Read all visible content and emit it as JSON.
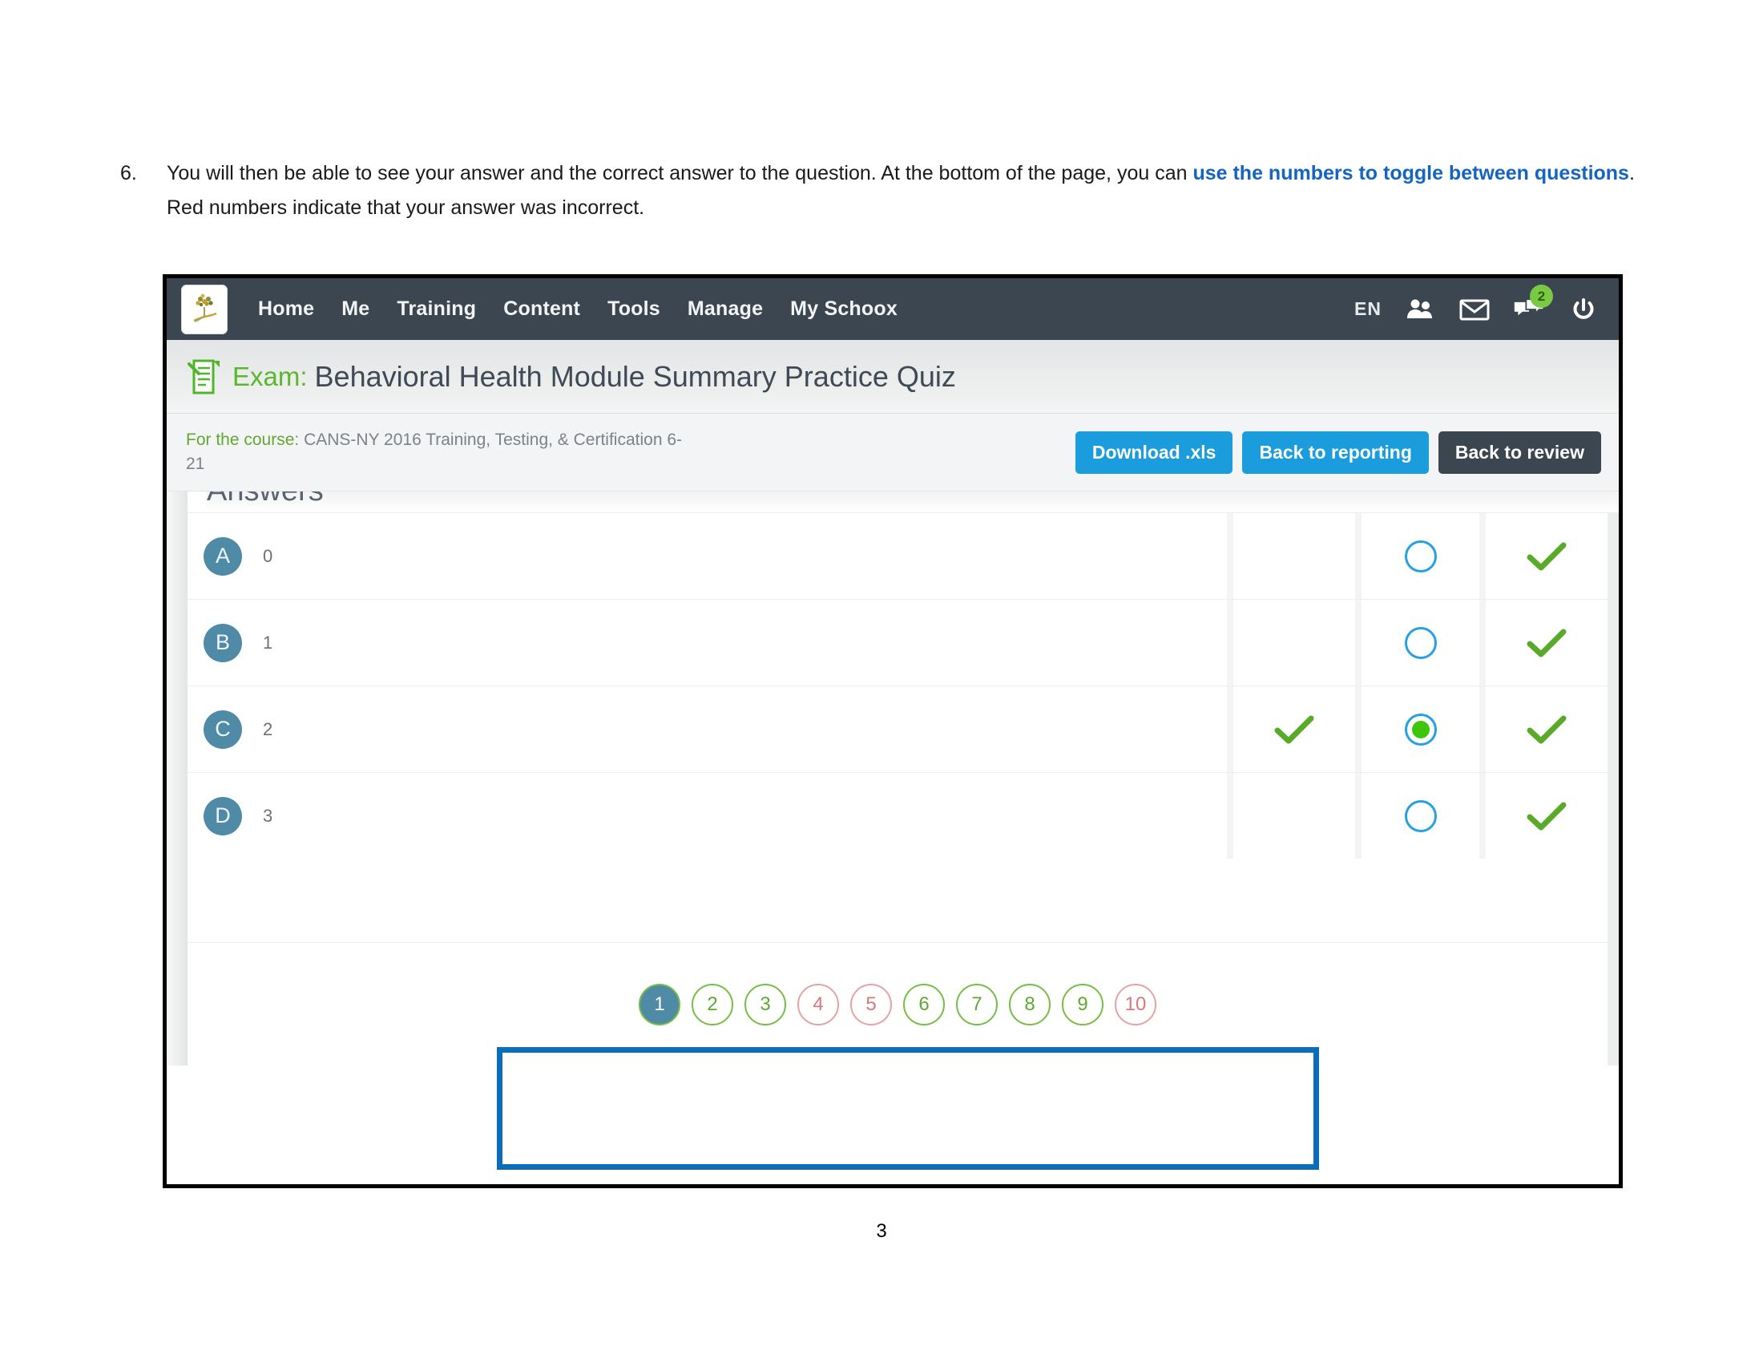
{
  "instruction": {
    "number": "6.",
    "part1": "You will then be able to see your answer and the correct answer to the question.  At the bottom of the page, you can ",
    "link1": "use the numbers to toggle between questions",
    "part2": ". Red numbers indicate that your answer was incorrect."
  },
  "navbar": {
    "logo_icon": "tree-logo-icon",
    "links": [
      {
        "label": "Home"
      },
      {
        "label": "Me"
      },
      {
        "label": "Training"
      },
      {
        "label": "Content"
      },
      {
        "label": "Tools"
      },
      {
        "label": "Manage"
      },
      {
        "label": "My Schoox"
      }
    ],
    "language": "EN",
    "icons": [
      {
        "name": "friends-icon"
      },
      {
        "name": "mail-icon"
      },
      {
        "name": "chat-icon",
        "badge": "2"
      },
      {
        "name": "power-icon"
      }
    ]
  },
  "titlebar": {
    "icon": "exam-document-icon",
    "prefix": "Exam:",
    "title": "Behavioral Health Module Summary Practice Quiz"
  },
  "coursebar": {
    "course_label": "For the course:",
    "course_name": " CANS-NY 2016 Training, Testing, & Certification 6-21",
    "buttons": [
      {
        "label": "Download .xls",
        "style": "blue"
      },
      {
        "label": "Back to reporting",
        "style": "blue"
      },
      {
        "label": "Back to review",
        "style": "dark"
      }
    ]
  },
  "answers_panel": {
    "heading": "Answers",
    "rows": [
      {
        "letter": "A",
        "text": "0",
        "correct_mark": false,
        "user_selected": false,
        "user_filled": false,
        "valid_mark": true
      },
      {
        "letter": "B",
        "text": "1",
        "correct_mark": false,
        "user_selected": false,
        "user_filled": false,
        "valid_mark": true
      },
      {
        "letter": "C",
        "text": "2",
        "correct_mark": true,
        "user_selected": true,
        "user_filled": true,
        "valid_mark": true
      },
      {
        "letter": "D",
        "text": "3",
        "correct_mark": false,
        "user_selected": false,
        "user_filled": false,
        "valid_mark": true
      }
    ]
  },
  "pagination": {
    "items": [
      {
        "label": "1",
        "state": "active"
      },
      {
        "label": "2",
        "state": "correct"
      },
      {
        "label": "3",
        "state": "correct"
      },
      {
        "label": "4",
        "state": "wrong"
      },
      {
        "label": "5",
        "state": "wrong"
      },
      {
        "label": "6",
        "state": "correct"
      },
      {
        "label": "7",
        "state": "correct"
      },
      {
        "label": "8",
        "state": "correct"
      },
      {
        "label": "9",
        "state": "correct"
      },
      {
        "label": "10",
        "state": "wrong"
      }
    ]
  },
  "annotation": {
    "name": "pagination-highlight-box",
    "color": "#0b6cb8"
  },
  "footer": {
    "page_number": "3"
  },
  "colors": {
    "nav_bg": "#3b4651",
    "accent_blue": "#1b9ddd",
    "accent_green": "#5bb82a",
    "option_blue": "#4f8aa6",
    "annotation_blue": "#0b6cb8",
    "wrong_red": "#d4787c"
  }
}
